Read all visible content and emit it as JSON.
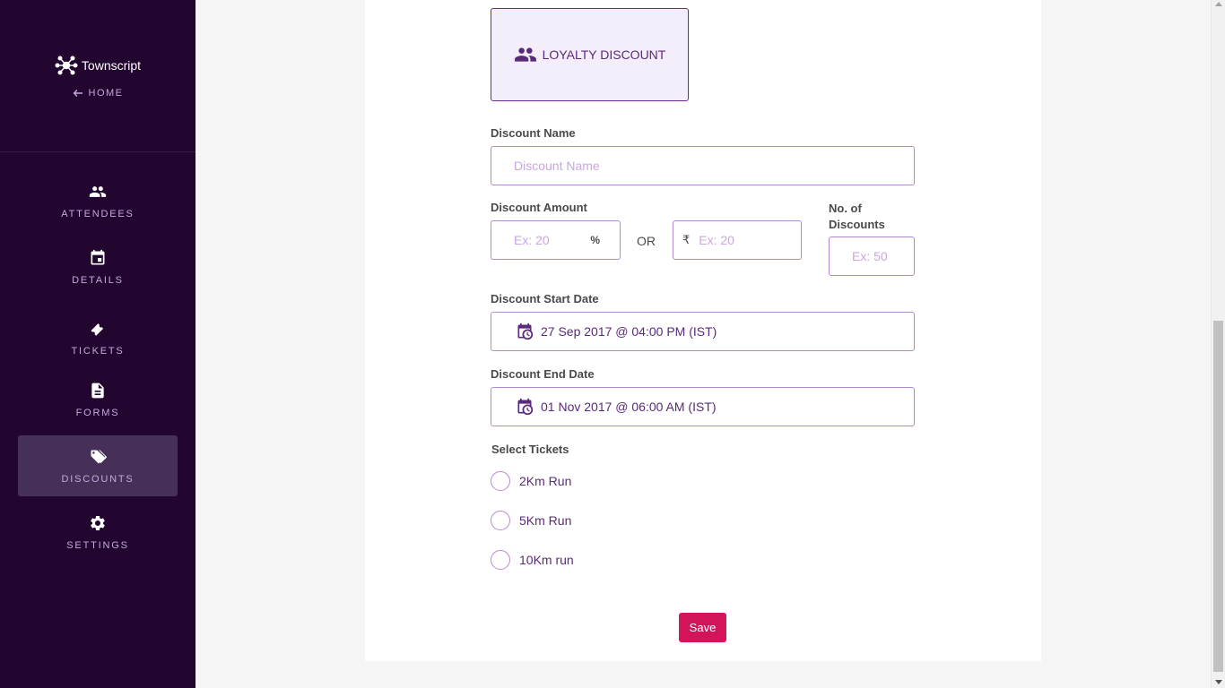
{
  "sidebar": {
    "brand": "Townscript",
    "home_label": "HOME",
    "items": [
      {
        "label": "ATTENDEES",
        "icon": "people-icon"
      },
      {
        "label": "DETAILS",
        "icon": "calendar-icon"
      },
      {
        "label": "TICKETS",
        "icon": "ticket-icon"
      },
      {
        "label": "FORMS",
        "icon": "document-icon"
      },
      {
        "label": "DISCOUNTS",
        "icon": "tags-icon",
        "active": true
      },
      {
        "label": "SETTINGS",
        "icon": "gear-icon"
      }
    ]
  },
  "discount_type": {
    "label": "LOYALTY DISCOUNT"
  },
  "form": {
    "name_label": "Discount Name",
    "name_placeholder": "Discount Name",
    "amount_label": "Discount Amount",
    "percent_placeholder": "Ex: 20",
    "percent_symbol": "%",
    "or_label": "OR",
    "currency_symbol": "₹",
    "amount_placeholder": "Ex: 20",
    "count_label": "No. of Discounts",
    "count_placeholder": "Ex: 50",
    "start_label": "Discount Start Date",
    "start_value": "27 Sep 2017 @ 04:00 PM (IST)",
    "end_label": "Discount End Date",
    "end_value": "01 Nov 2017 @ 06:00 AM (IST)",
    "tickets_label": "Select Tickets",
    "tickets": [
      "2Km Run",
      "5Km Run",
      "10Km run"
    ],
    "save_label": "Save"
  },
  "colors": {
    "sidebar_bg": "#22062f",
    "accent": "#6b2c91",
    "save_button": "#d4145a"
  }
}
